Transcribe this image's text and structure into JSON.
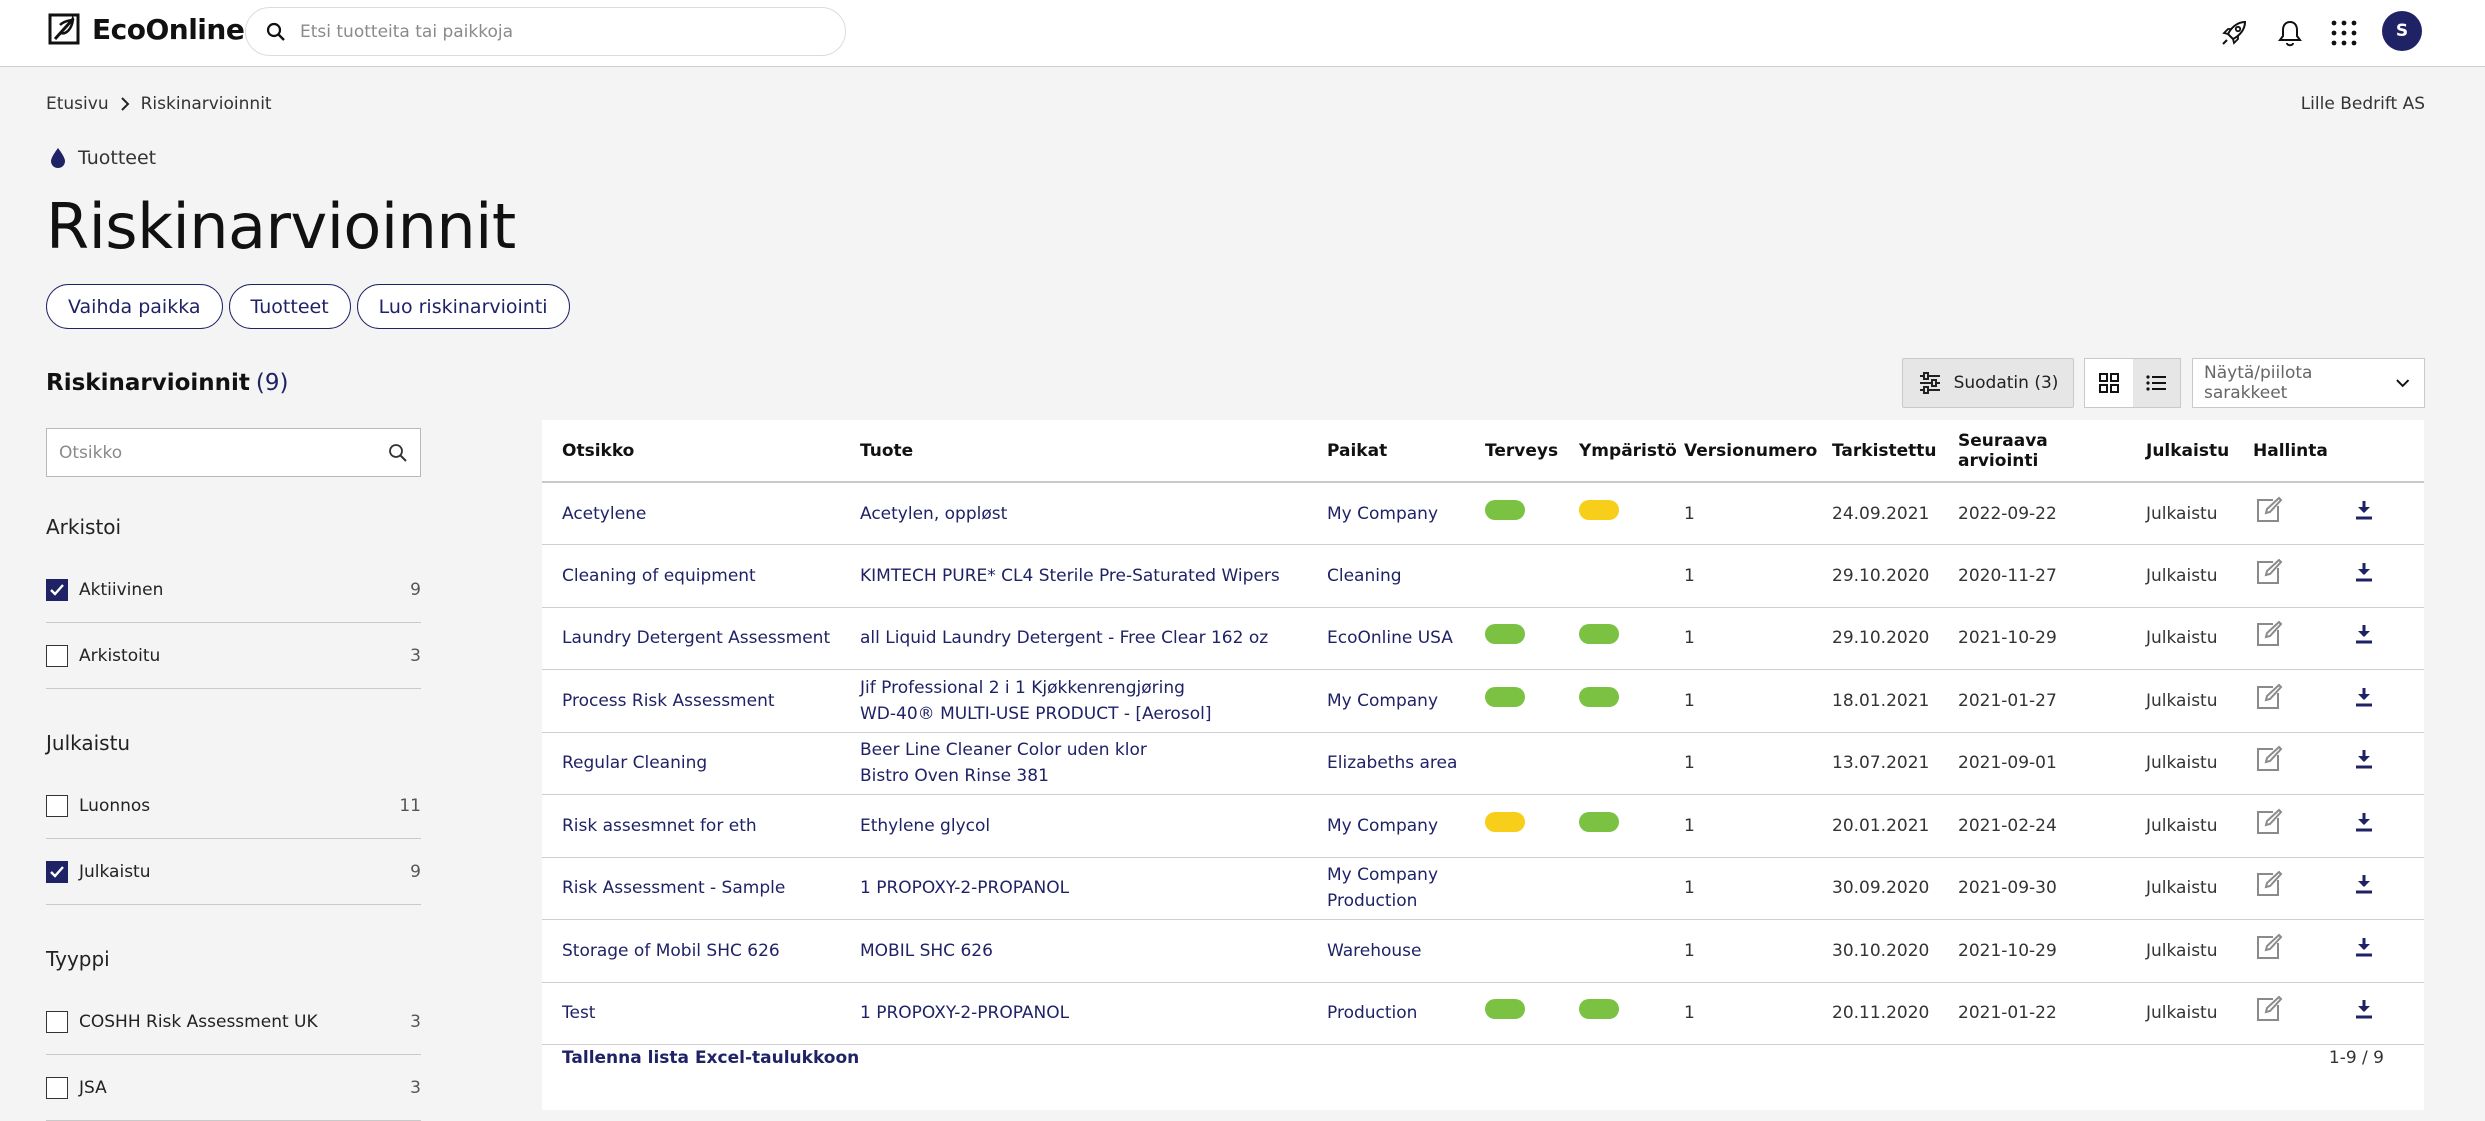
{
  "app": {
    "brand": "EcoOnline",
    "search_placeholder": "Etsi tuotteita tai paikkoja",
    "avatar_initial": "S",
    "accent": "#1f2366"
  },
  "breadcrumb": {
    "home": "Etusivu",
    "current": "Riskinarvioinnit"
  },
  "company": "Lille Bedrift AS",
  "section_tag": "Tuotteet",
  "page_title": "Riskinarvioinnit",
  "pills": [
    "Vaihda paikka",
    "Tuotteet",
    "Luo riskinarviointi"
  ],
  "list": {
    "heading": "Riskinarvioinnit",
    "count": "(9)",
    "filter_label": "Suodatin (3)",
    "columns_select": "Näytä/piilota sarakkeet"
  },
  "sidebar": {
    "search_placeholder": "Otsikko",
    "groups": [
      {
        "title": "Arkistoi",
        "items": [
          {
            "label": "Aktiivinen",
            "count": "9",
            "checked": true
          },
          {
            "label": "Arkistoitu",
            "count": "3",
            "checked": false
          }
        ]
      },
      {
        "title": "Julkaistu",
        "items": [
          {
            "label": "Luonnos",
            "count": "11",
            "checked": false
          },
          {
            "label": "Julkaistu",
            "count": "9",
            "checked": true
          }
        ]
      },
      {
        "title": "Tyyppi",
        "items": [
          {
            "label": "COSHH Risk Assessment UK",
            "count": "3",
            "checked": false
          },
          {
            "label": "JSA",
            "count": "3",
            "checked": false
          }
        ]
      }
    ]
  },
  "table": {
    "headers": [
      "Otsikko",
      "Tuote",
      "Paikat",
      "Terveys",
      "Ympäristö",
      "Versionumero",
      "Tarkistettu",
      "Seuraava arviointi",
      "Julkaistu",
      "Hallinta"
    ],
    "rows": [
      {
        "title": "Acetylene",
        "product": [
          "Acetylen, oppløst"
        ],
        "places": [
          "My Company"
        ],
        "health": "green",
        "env": "yellow",
        "version": "1",
        "checked": "24.09.2021",
        "next": "2022-09-22",
        "published": "Julkaistu"
      },
      {
        "title": "Cleaning of equipment",
        "product": [
          "KIMTECH PURE* CL4 Sterile Pre-Saturated Wipers"
        ],
        "places": [
          "Cleaning"
        ],
        "health": "",
        "env": "",
        "version": "1",
        "checked": "29.10.2020",
        "next": "2020-11-27",
        "published": "Julkaistu"
      },
      {
        "title": "Laundry Detergent Assessment",
        "product": [
          "all Liquid Laundry Detergent - Free Clear 162 oz"
        ],
        "places": [
          "EcoOnline USA"
        ],
        "health": "green",
        "env": "green",
        "version": "1",
        "checked": "29.10.2020",
        "next": "2021-10-29",
        "published": "Julkaistu"
      },
      {
        "title": "Process Risk Assessment",
        "product": [
          "Jif Professional 2 i 1 Kjøkkenrengjøring",
          "WD-40® MULTI-USE PRODUCT - [Aerosol]"
        ],
        "places": [
          "My Company"
        ],
        "health": "green",
        "env": "green",
        "version": "1",
        "checked": "18.01.2021",
        "next": "2021-01-27",
        "published": "Julkaistu"
      },
      {
        "title": "Regular Cleaning",
        "product": [
          "Beer Line Cleaner Color uden klor",
          "Bistro Oven Rinse 381"
        ],
        "places": [
          "Elizabeths area"
        ],
        "health": "",
        "env": "",
        "version": "1",
        "checked": "13.07.2021",
        "next": "2021-09-01",
        "published": "Julkaistu"
      },
      {
        "title": "Risk assesmnet for eth",
        "product": [
          "Ethylene glycol"
        ],
        "places": [
          "My Company"
        ],
        "health": "yellow",
        "env": "green",
        "version": "1",
        "checked": "20.01.2021",
        "next": "2021-02-24",
        "published": "Julkaistu"
      },
      {
        "title": "Risk Assessment - Sample",
        "product": [
          "1 PROPOXY-2-PROPANOL"
        ],
        "places": [
          "My Company",
          "Production"
        ],
        "health": "",
        "env": "",
        "version": "1",
        "checked": "30.09.2020",
        "next": "2021-09-30",
        "published": "Julkaistu"
      },
      {
        "title": "Storage of Mobil SHC 626",
        "product": [
          "MOBIL SHC 626"
        ],
        "places": [
          "Warehouse"
        ],
        "health": "",
        "env": "",
        "version": "1",
        "checked": "30.10.2020",
        "next": "2021-10-29",
        "published": "Julkaistu"
      },
      {
        "title": "Test",
        "product": [
          "1 PROPOXY-2-PROPANOL"
        ],
        "places": [
          "Production"
        ],
        "health": "green",
        "env": "green",
        "version": "1",
        "checked": "20.11.2020",
        "next": "2021-01-22",
        "published": "Julkaistu"
      }
    ],
    "export_label": "Tallenna lista Excel-taulukkoon",
    "pagination": "1-9 / 9"
  },
  "colors": {
    "green": "#7cc242",
    "yellow": "#f7cf1b",
    "navy": "#1f2366"
  }
}
